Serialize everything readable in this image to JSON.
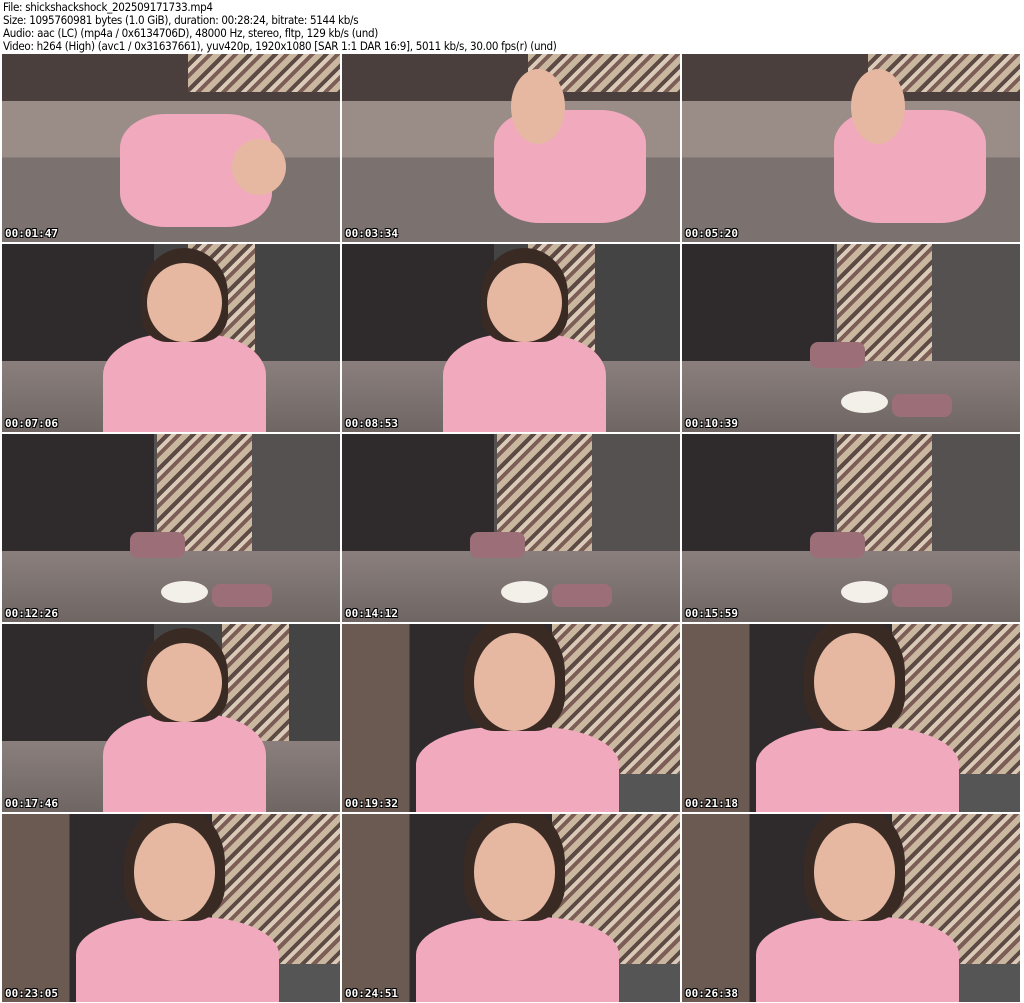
{
  "header": {
    "file": "File: shickshackshock_202509171733.mp4",
    "size": "Size: 1095760981 bytes (1.0 GiB), duration: 00:28:24, bitrate: 5144 kb/s",
    "audio": "Audio: aac (LC) (mp4a / 0x6134706D), 48000 Hz, stereo, fltp, 129 kb/s (und)",
    "video": "Video: h264 (High) (avc1 / 0x31637661), yuv420p, 1920x1080 [SAR 1:1 DAR 16:9], 5011 kb/s, 30.00 fps(r) (und)"
  },
  "thumbnails": [
    {
      "timestamp": "00:01:47",
      "scene": "lying"
    },
    {
      "timestamp": "00:03:34",
      "scene": "lying"
    },
    {
      "timestamp": "00:05:20",
      "scene": "lying"
    },
    {
      "timestamp": "00:07:06",
      "scene": "sitting"
    },
    {
      "timestamp": "00:08:53",
      "scene": "sitting"
    },
    {
      "timestamp": "00:10:39",
      "scene": "empty"
    },
    {
      "timestamp": "00:12:26",
      "scene": "empty"
    },
    {
      "timestamp": "00:14:12",
      "scene": "empty"
    },
    {
      "timestamp": "00:15:59",
      "scene": "empty"
    },
    {
      "timestamp": "00:17:46",
      "scene": "sitting"
    },
    {
      "timestamp": "00:19:32",
      "scene": "close"
    },
    {
      "timestamp": "00:21:18",
      "scene": "close"
    },
    {
      "timestamp": "00:23:05",
      "scene": "close"
    },
    {
      "timestamp": "00:24:51",
      "scene": "close"
    },
    {
      "timestamp": "00:26:38",
      "scene": "close"
    }
  ]
}
